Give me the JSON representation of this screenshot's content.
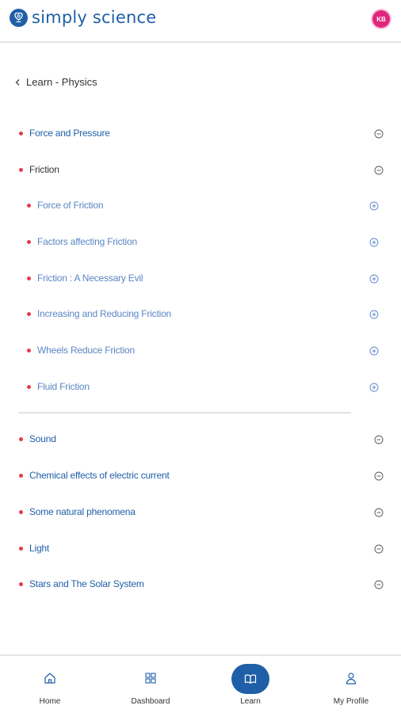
{
  "app": {
    "brand": "simply science",
    "avatar_initials": "KB",
    "brand_color": "#1f5fa8",
    "avatar_color": "#e0267d"
  },
  "breadcrumb": {
    "label": "Learn - Physics"
  },
  "topics": [
    {
      "label": "Force and Pressure",
      "type": "main",
      "state": "collapsed"
    },
    {
      "label": "Friction",
      "type": "main",
      "state": "expanded"
    },
    {
      "label": "Force of Friction",
      "type": "sub",
      "state": "collapsed"
    },
    {
      "label": "Factors affecting Friction",
      "type": "sub",
      "state": "collapsed"
    },
    {
      "label": "Friction : A Necessary Evil",
      "type": "sub",
      "state": "collapsed"
    },
    {
      "label": "Increasing and Reducing Friction",
      "type": "sub",
      "state": "collapsed"
    },
    {
      "label": "Wheels Reduce Friction",
      "type": "sub",
      "state": "collapsed"
    },
    {
      "label": "Fluid Friction",
      "type": "sub",
      "state": "collapsed"
    },
    {
      "label": "Sound",
      "type": "main",
      "state": "collapsed"
    },
    {
      "label": "Chemical effects of electric current",
      "type": "main",
      "state": "collapsed"
    },
    {
      "label": "Some natural phenomena",
      "type": "main",
      "state": "collapsed"
    },
    {
      "label": "Light",
      "type": "main",
      "state": "collapsed"
    },
    {
      "label": "Stars and The Solar System",
      "type": "main",
      "state": "collapsed"
    }
  ],
  "bottom_nav": [
    {
      "label": "Home",
      "icon": "home-icon",
      "active": false
    },
    {
      "label": "Dashboard",
      "icon": "dashboard-icon",
      "active": false
    },
    {
      "label": "Learn",
      "icon": "book-icon",
      "active": true
    },
    {
      "label": "My Profile",
      "icon": "profile-icon",
      "active": false
    }
  ]
}
